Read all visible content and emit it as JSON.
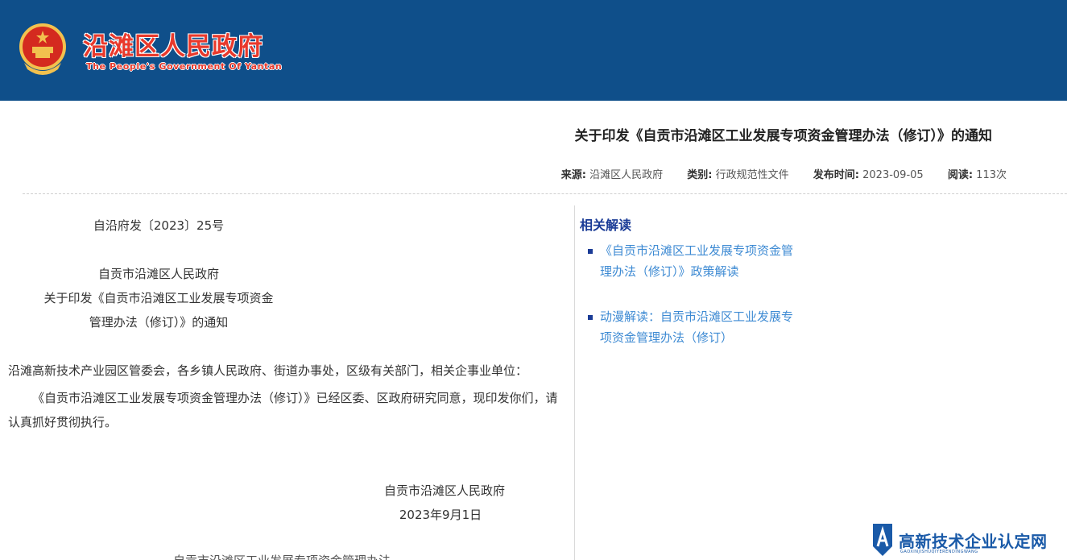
{
  "header": {
    "site_title": "沿滩区人民政府",
    "site_subtitle": "The People's Government Of Yantan",
    "bg_color": "#0f4f8a",
    "title_color": "#e8392c"
  },
  "article": {
    "title": "关于印发《自贡市沿滩区工业发展专项资金管理办法（修订）》的通知",
    "meta": {
      "source_label": "来源:",
      "source": "沿滩区人民政府",
      "category_label": "类别:",
      "category": "行政规范性文件",
      "date_label": "发布时间:",
      "date": "2023-09-05",
      "views_label": "阅读:",
      "views": "113次"
    },
    "doc_number": "自沿府发〔2023〕25号",
    "heading_line1": "自贡市沿滩区人民政府",
    "heading_line2": "关于印发《自贡市沿滩区工业发展专项资金",
    "heading_line3": "管理办法（修订）》的通知",
    "addressee": "沿滩高新技术产业园区管委会，各乡镇人民政府、街道办事处，区级有关部门，相关企事业单位：",
    "body": "《自贡市沿滩区工业发展专项资金管理办法（修订）》已经区委、区政府研究同意，现印发你们，请认真抓好贯彻执行。",
    "signature_org": "自贡市沿滩区人民政府",
    "signature_date": "2023年9月1日",
    "cut_line": "自贡市沿滩区工业发展专项资金管理办法"
  },
  "related": {
    "title": "相关解读",
    "items": [
      {
        "label": "《自贡市沿滩区工业发展专项资金管理办法（修订）》政策解读"
      },
      {
        "label": "动漫解读：自贡市沿滩区工业发展专项资金管理办法（修订）"
      }
    ]
  },
  "watermark": {
    "text": "高新技术企业认定网",
    "subtext": "GAOXINJISHUQIYERENDINGWANG"
  }
}
